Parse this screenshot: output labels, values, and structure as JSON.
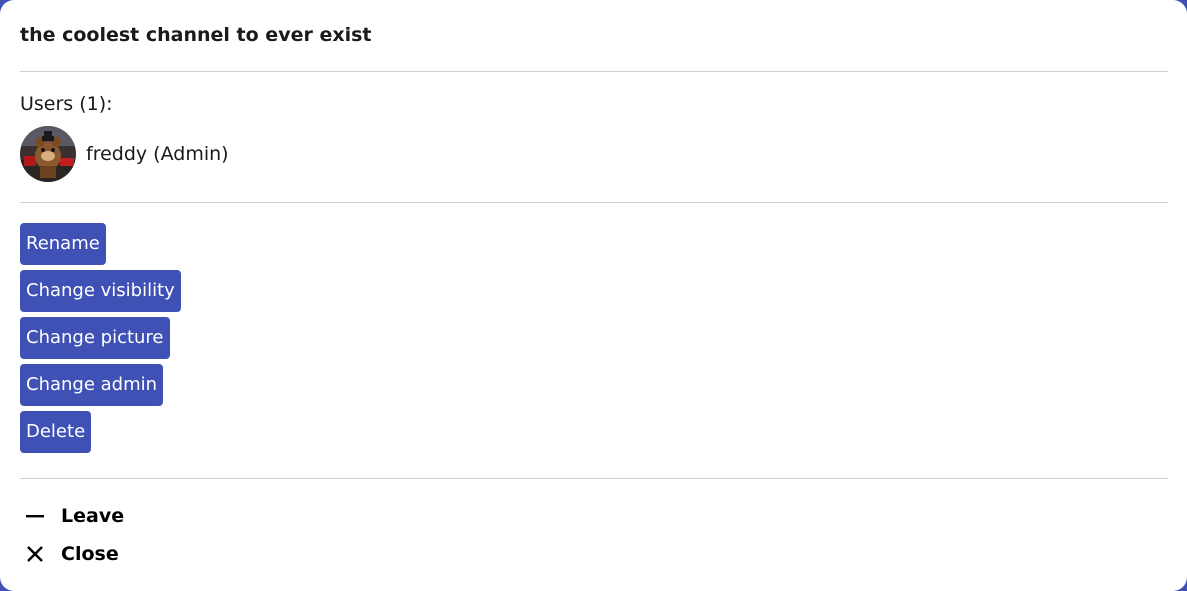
{
  "dialog": {
    "title": "the coolest channel to ever exist"
  },
  "users": {
    "heading": "Users (1):",
    "list": [
      {
        "name": "freddy (Admin)",
        "avatar_icon": "user-avatar-image"
      }
    ]
  },
  "actions": {
    "rename": "Rename",
    "change_visibility": "Change visibility",
    "change_picture": "Change picture",
    "change_admin": "Change admin",
    "delete": "Delete"
  },
  "footer": {
    "leave": {
      "label": "Leave",
      "icon": "minus-icon"
    },
    "close": {
      "label": "Close",
      "icon": "close-icon"
    }
  },
  "colors": {
    "accent": "#3f51b5",
    "divider": "#cfcfcf",
    "background": "#ffffff"
  }
}
